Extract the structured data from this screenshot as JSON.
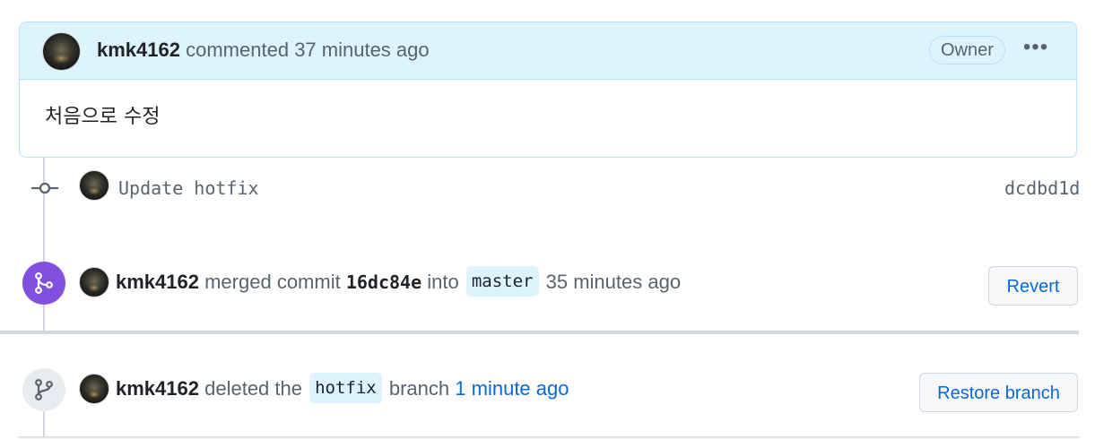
{
  "comment": {
    "author": "kmk4162",
    "action": "commented",
    "time": "37 minutes ago",
    "role_badge": "Owner",
    "body": "처음으로 수정",
    "header_bg": "#ddf4ff"
  },
  "commit": {
    "message": "Update hotfix",
    "sha": "dcdbd1d"
  },
  "merge_event": {
    "author": "kmk4162",
    "verb": "merged commit",
    "sha": "16dc84e",
    "into": "into",
    "branch": "master",
    "time": "35 minutes ago",
    "button_label": "Revert",
    "badge_color": "#8250df"
  },
  "delete_event": {
    "author": "kmk4162",
    "verb": "deleted the",
    "branch": "hotfix",
    "suffix": "branch",
    "time": "1 minute ago",
    "button_label": "Restore branch"
  },
  "icons": {
    "commit": "git-commit-icon",
    "merge": "git-merge-icon",
    "branch": "git-branch-icon",
    "more": "kebab-horizontal-icon"
  }
}
